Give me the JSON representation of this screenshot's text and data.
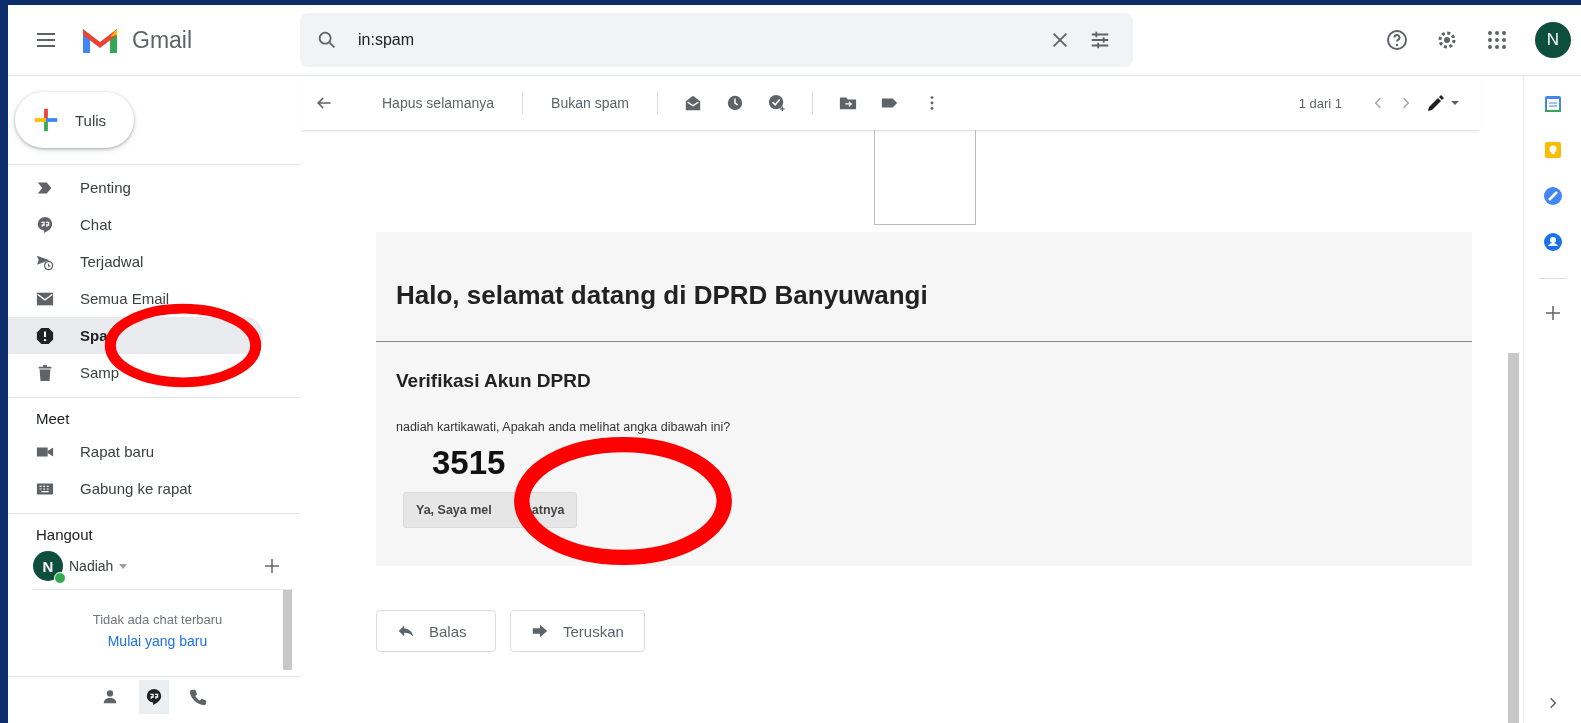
{
  "header": {
    "app_name": "Gmail",
    "search": {
      "value": "in:spam"
    },
    "avatar": "N"
  },
  "compose": {
    "label": "Tulis"
  },
  "sidebar": {
    "items": [
      {
        "label": "Penting",
        "kind": "label",
        "selected": false
      },
      {
        "label": "Chat",
        "kind": "chat",
        "selected": false
      },
      {
        "label": "Terjadwal",
        "kind": "scheduled",
        "selected": false
      },
      {
        "label": "Semua Email",
        "kind": "mail",
        "selected": false
      },
      {
        "label": "Spa",
        "kind": "spam",
        "selected": true
      },
      {
        "label": "Samp",
        "kind": "trash",
        "selected": false
      }
    ],
    "meet": {
      "title": "Meet",
      "items": [
        {
          "label": "Rapat baru",
          "kind": "video"
        },
        {
          "label": "Gabung ke rapat",
          "kind": "keyboard"
        }
      ]
    },
    "hangout": {
      "title": "Hangout",
      "user": "Nadiah",
      "avatar": "N",
      "online": true,
      "empty_text": "Tidak ada chat terbaru",
      "start_link": "Mulai yang baru"
    }
  },
  "toolbar": {
    "actions": [
      "Hapus selamanya",
      "Bukan spam"
    ],
    "pager": "1 dari 1"
  },
  "email": {
    "heading": "Halo, selamat datang di DPRD Banyuwangi",
    "subheading": "Verifikasi Akun DPRD",
    "message": "nadiah kartikawati, Apakah anda melihat angka dibawah ini?",
    "code": "3515",
    "confirm_button": {
      "label_before": "Ya, Saya mel",
      "label_after": "atnya"
    },
    "replies": [
      {
        "label": "Balas",
        "kind": "reply"
      },
      {
        "label": "Teruskan",
        "kind": "forward"
      }
    ]
  },
  "annotations": [
    {
      "kind": "ellipse"
    },
    {
      "kind": "ellipse"
    }
  ]
}
